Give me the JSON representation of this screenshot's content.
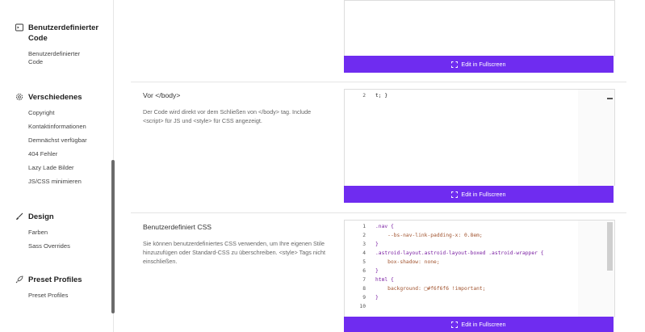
{
  "sidebar": {
    "sections": [
      {
        "title": "Benutzerdefinierter Code",
        "icon": "code-window-icon",
        "items": [
          "Benutzerdefinierter Code"
        ]
      },
      {
        "title": "Verschiedenes",
        "icon": "gear-icon",
        "items": [
          "Copyright",
          "Kontaktinformationen",
          "Demnächst verfügbar",
          "404 Fehler",
          "Lazy Lade Bilder",
          "JS/CSS minimieren"
        ]
      },
      {
        "title": "Design",
        "icon": "brush-icon",
        "items": [
          "Farben",
          "Sass Overrides"
        ]
      },
      {
        "title": "Preset Profiles",
        "icon": "rocket-icon",
        "items": [
          "Preset Profiles"
        ]
      }
    ]
  },
  "fullscreen_label": "Edit in Fullscreen",
  "rows": [
    {
      "title": "Vor </body>",
      "description": "Der Code wird direkt vor dem Schließen von </body> tag. Include <script> für JS und <style> für CSS angezeigt.",
      "code_lines": [
        {
          "num": "2",
          "text": "t; }"
        }
      ]
    },
    {
      "title": "Benutzerdefiniert CSS",
      "description": "Sie können benutzerdefiniertes CSS verwenden, um Ihre eigenen Stile hinzuzufügen oder Standard-CSS zu überschreiben. <style> Tags nicht einschließen.",
      "code_lines": [
        {
          "num": "1",
          "text": ".nav {"
        },
        {
          "num": "2",
          "text": "    --bs-nav-link-padding-x: 0.8em;"
        },
        {
          "num": "3",
          "text": "}"
        },
        {
          "num": "4",
          "text": ".astroid-layout.astroid-layout-boxed .astroid-wrapper {"
        },
        {
          "num": "5",
          "text": "    box-shadow: none;"
        },
        {
          "num": "6",
          "text": "}"
        },
        {
          "num": "7",
          "text": "html {"
        },
        {
          "num": "8",
          "text": "    background: □#f6f6f6 !important;"
        },
        {
          "num": "9",
          "text": "}"
        },
        {
          "num": "10",
          "text": ""
        }
      ]
    }
  ]
}
